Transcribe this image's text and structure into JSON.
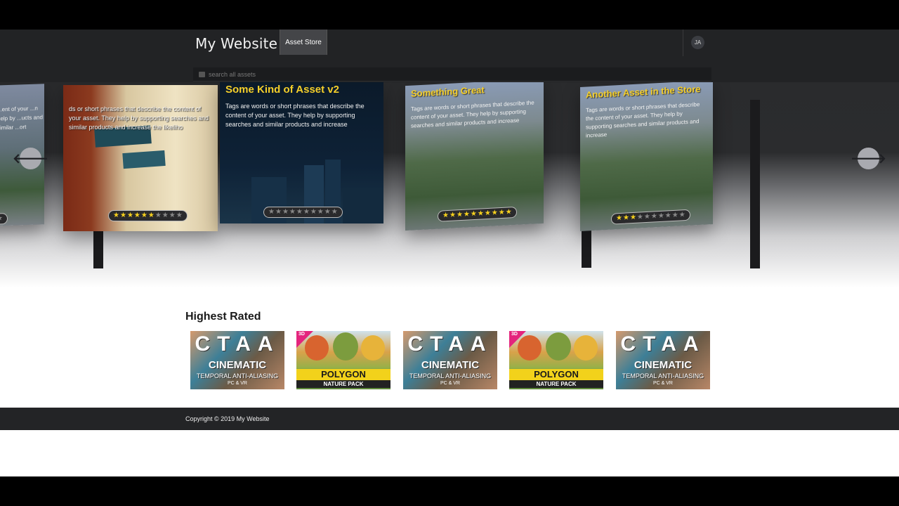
{
  "header": {
    "brand": "My Website",
    "nav_tab": "Asset Store",
    "user_initials": "JA"
  },
  "search": {
    "placeholder": "search all assets"
  },
  "carousel": {
    "cards": [
      {
        "title": "",
        "desc": "...ent of your ...n help by ...ucts and similar ...ort",
        "rating": 1
      },
      {
        "title": "",
        "desc": "ds or short phrases that describe the content of your asset. They help by supporting searches and similar products and increase the likeliho",
        "rating": 6
      },
      {
        "title": "Some Kind of Asset v2",
        "desc": "Tags are words or short phrases that describe the content of your asset. They help by supporting searches and similar products and increase",
        "rating": 0
      },
      {
        "title": "Something Great",
        "desc": "Tags are words or short phrases that describe the content of your asset. They help by supporting searches and similar products and increase",
        "rating": 10
      },
      {
        "title": "Another Asset in the Store",
        "desc": "Tags are words or short phrases that describe the content of your asset. They help by supporting searches and similar products and increase",
        "rating": 3
      }
    ],
    "max_stars": 10,
    "prev_icon": "arrow-left-icon",
    "next_icon": "arrow-right-icon"
  },
  "highest_rated": {
    "title": "Highest Rated",
    "items": [
      {
        "kind": "ctaa",
        "line1": "CTAA",
        "line2": "CINEMATIC",
        "line3": "TEMPORAL ANTI-ALIASING",
        "line4": "PC & VR"
      },
      {
        "kind": "poly",
        "badge": "3D",
        "line1": "POLYGON",
        "line2": "NATURE PACK"
      },
      {
        "kind": "ctaa",
        "line1": "CTAA",
        "line2": "CINEMATIC",
        "line3": "TEMPORAL ANTI-ALIASING",
        "line4": "PC & VR"
      },
      {
        "kind": "poly",
        "badge": "3D",
        "line1": "POLYGON",
        "line2": "NATURE PACK"
      },
      {
        "kind": "ctaa",
        "line1": "CTAA",
        "line2": "CINEMATIC",
        "line3": "TEMPORAL ANTI-ALIASING",
        "line4": "PC & VR"
      }
    ]
  },
  "footer": {
    "copyright": "Copyright © 2019 My Website"
  },
  "colors": {
    "navbar": "#222325",
    "accent_yellow": "#f5cf2a",
    "footer": "#232426"
  }
}
